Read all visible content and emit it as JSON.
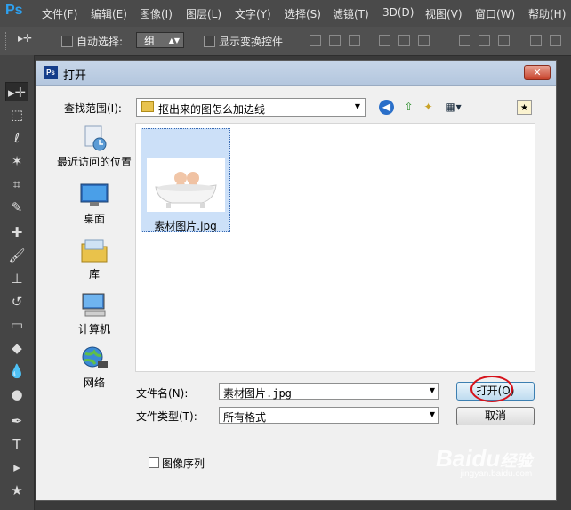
{
  "app": {
    "logo": "Ps",
    "menu": [
      "文件(F)",
      "编辑(E)",
      "图像(I)",
      "图层(L)",
      "文字(Y)",
      "选择(S)",
      "滤镜(T)",
      "3D(D)",
      "视图(V)",
      "窗口(W)",
      "帮助(H)"
    ]
  },
  "options_bar": {
    "move_tool": "▸✛",
    "auto_select_label": "自动选择:",
    "auto_select_value": "组",
    "show_transform_label": "显示变换控件"
  },
  "toolbox": {
    "tools": [
      "move-tool",
      "marquee-tool",
      "lasso-tool",
      "magic-wand-tool",
      "crop-tool",
      "eyedropper-tool",
      "healing-tool",
      "brush-tool",
      "stamp-tool",
      "history-brush-tool",
      "eraser-tool",
      "paint-bucket-tool",
      "blur-tool",
      "dodge-tool",
      "pen-tool",
      "type-tool",
      "path-select-tool",
      "shape-tool"
    ],
    "glyphs": [
      "▸✛",
      "⬚",
      "ℓ",
      "✶",
      "⌗",
      "✎",
      "✚",
      "🖌",
      "⊥",
      "↺",
      "▭",
      "◆",
      "💧",
      "●",
      "✒",
      "T",
      "▸",
      "★"
    ]
  },
  "dialog": {
    "title_icon": "Ps",
    "title": "打开",
    "close_glyph": "✕",
    "look_in_label": "查找范围(I):",
    "look_in_value": "抠出来的图怎么加边线",
    "places": [
      {
        "label": "最近访问的位置",
        "icon": "recent-places-icon"
      },
      {
        "label": "桌面",
        "icon": "desktop-icon"
      },
      {
        "label": "库",
        "icon": "libraries-icon"
      },
      {
        "label": "计算机",
        "icon": "computer-icon"
      },
      {
        "label": "网络",
        "icon": "network-icon"
      }
    ],
    "files": [
      {
        "name": "素材图片.jpg"
      }
    ],
    "file_name_label": "文件名(N):",
    "file_name_value": "素材图片.jpg",
    "file_type_label": "文件类型(T):",
    "file_type_value": "所有格式",
    "open_button": "打开(O)",
    "cancel_button": "取消",
    "image_sequence_label": "图像序列"
  },
  "watermark": {
    "main": "Bai",
    "paw": "du",
    "suffix": "经验",
    "sub": "jingyan.baidu.com"
  },
  "colors": {
    "ps_blue": "#2ea1f0",
    "selection": "#cce0f8",
    "highlight_circle": "#d6121b"
  }
}
